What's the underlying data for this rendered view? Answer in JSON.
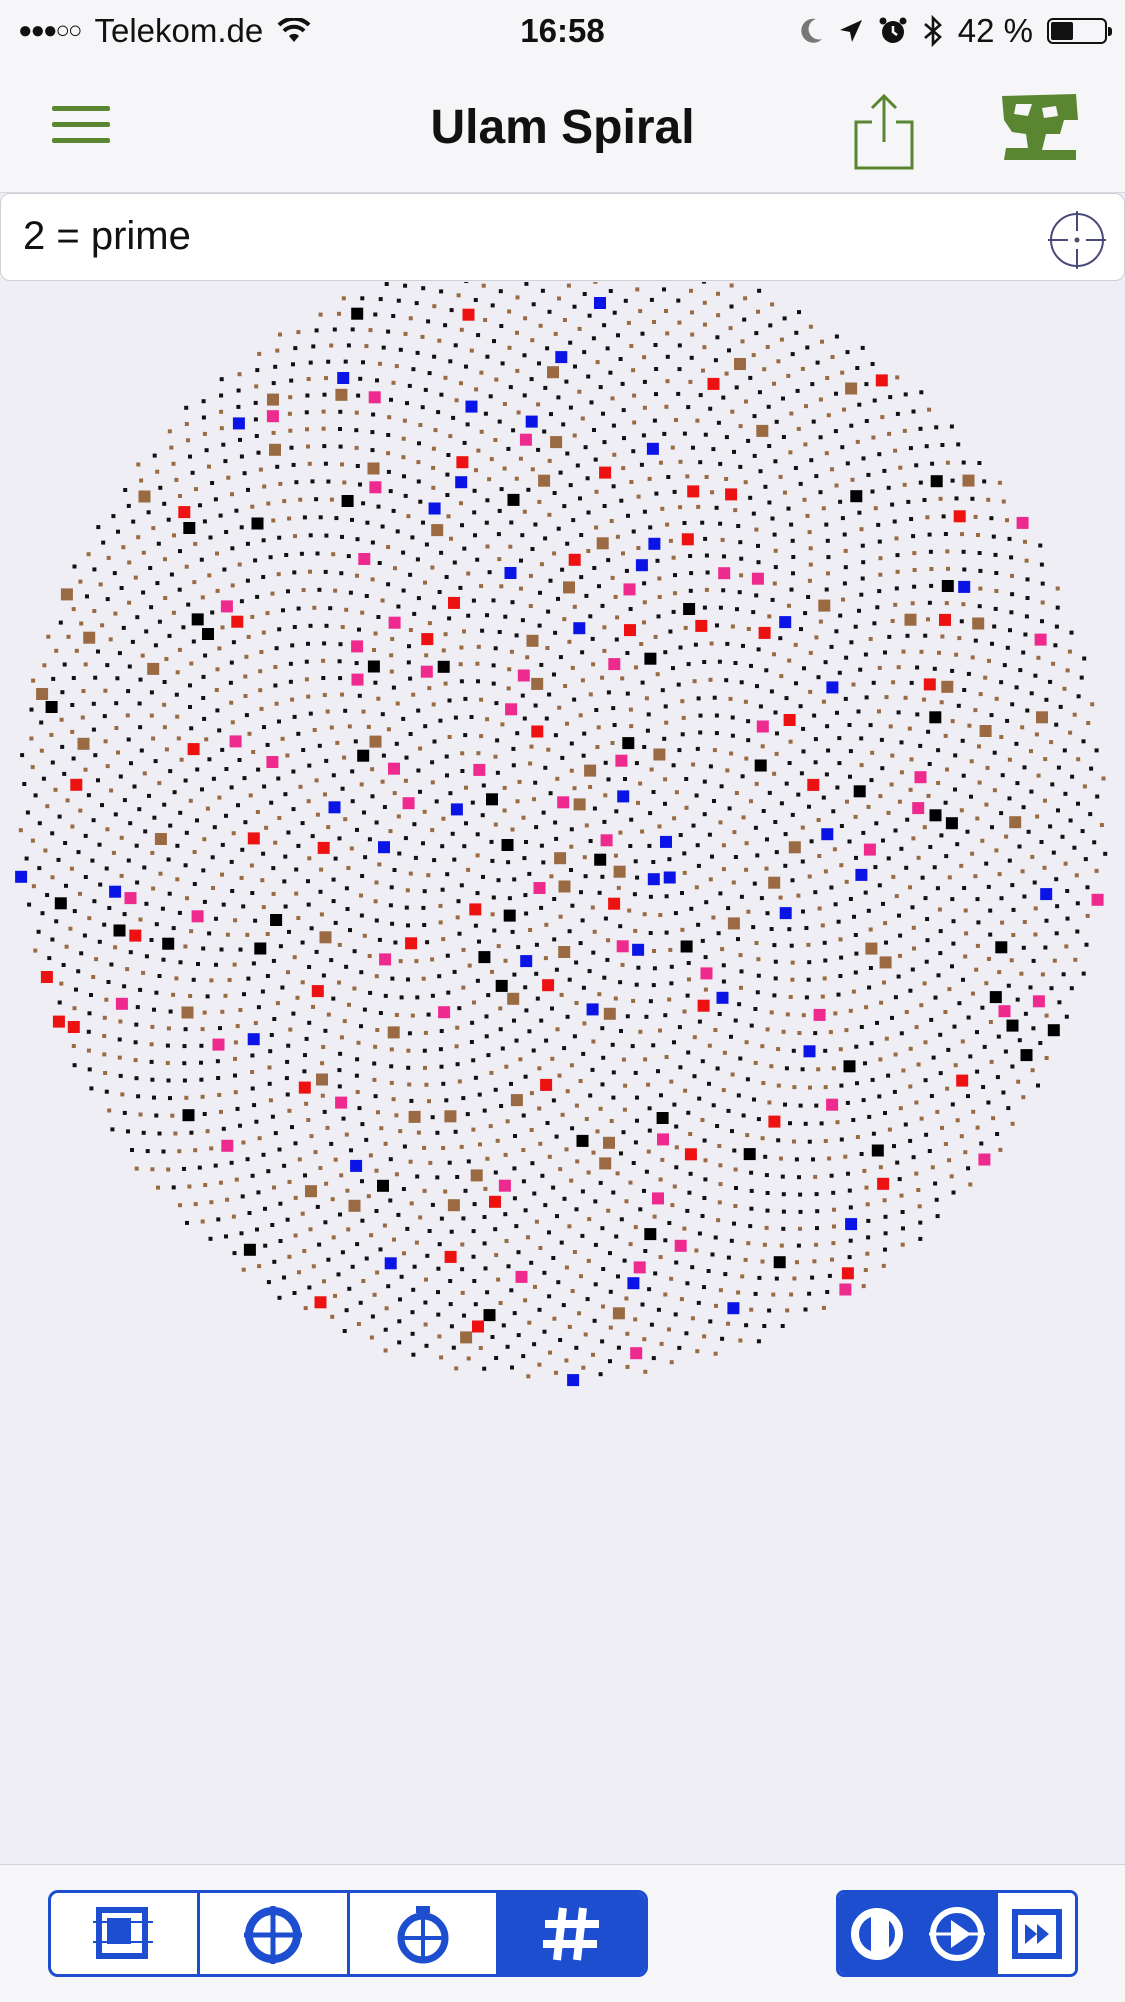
{
  "status_bar": {
    "signal": "●●●○○",
    "carrier": "Telekom.de",
    "time": "16:58",
    "battery": "42 %",
    "battery_level": 0.42
  },
  "nav": {
    "title": "Ulam Spiral",
    "menu_icon": "hamburger-menu-icon",
    "share_icon": "share-icon",
    "logo_icon": "app-logo-icon"
  },
  "info": {
    "text": "2 = prime",
    "icon": "crosshair-icon"
  },
  "spiral": {
    "colors": {
      "plain": "#111111",
      "brown": "#9a6a43",
      "black": "#000000",
      "blue": "#0a14e6",
      "red": "#ee1111",
      "pink": "#ee2a8f"
    }
  },
  "toolbar": {
    "left_segments": [
      "square-grid-icon",
      "crosshair-target-icon",
      "stopwatch-icon",
      "hash-pattern-icon"
    ],
    "active_segment": 3,
    "right_segments": [
      "rotate-icon",
      "play-icon",
      "fast-forward-icon"
    ],
    "accent": "#1c4ecf"
  }
}
